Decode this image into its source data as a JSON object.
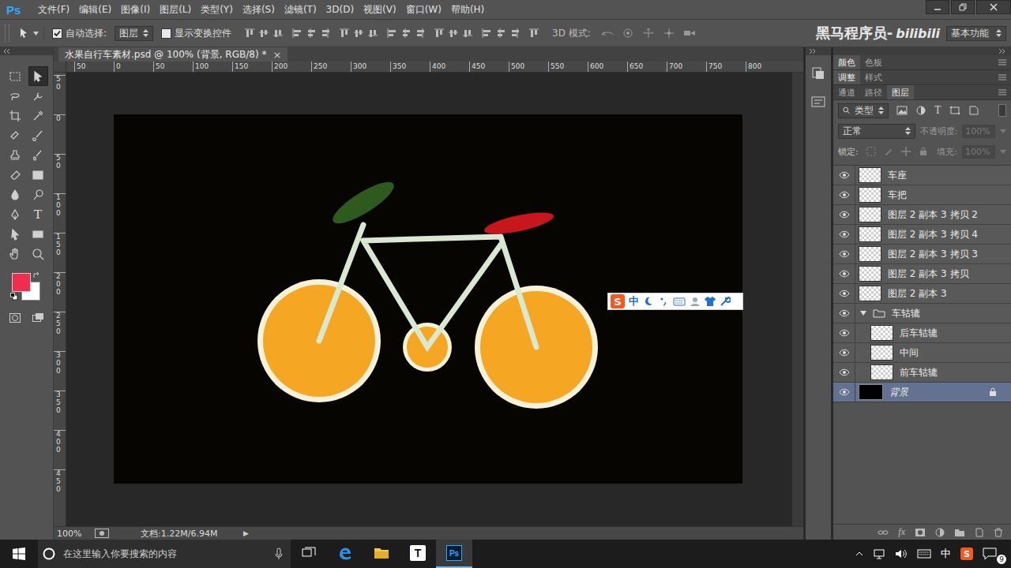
{
  "app": {
    "logo": "Ps"
  },
  "menu": [
    "文件(F)",
    "编辑(E)",
    "图像(I)",
    "图层(L)",
    "类型(Y)",
    "选择(S)",
    "滤镜(T)",
    "3D(D)",
    "视图(V)",
    "窗口(W)",
    "帮助(H)"
  ],
  "options_bar": {
    "auto_select": {
      "label": "自动选择:",
      "checked": true
    },
    "auto_select_target": "图层",
    "show_transform": {
      "label": "显示变换控件",
      "checked": false
    },
    "mode_3d_label": "3D 模式:",
    "workspace": "基本功能"
  },
  "watermark": {
    "text": "黑马程序员-",
    "brand": "bilibili"
  },
  "tools": [
    {
      "selected": false
    },
    {
      "selected": true
    },
    {
      "selected": false
    },
    {
      "selected": false
    },
    {
      "selected": false
    },
    {
      "selected": false
    },
    {
      "selected": false
    },
    {
      "selected": false
    },
    {
      "selected": false
    },
    {
      "selected": false
    },
    {
      "selected": false
    },
    {
      "selected": false
    },
    {
      "selected": false
    },
    {
      "selected": false
    },
    {
      "selected": false
    },
    {
      "selected": false,
      "glyph": "T"
    },
    {
      "selected": false
    },
    {
      "selected": false
    },
    {
      "selected": false
    },
    {
      "selected": false
    }
  ],
  "colors": {
    "foreground": "#ee2d4f",
    "background": "#ffffff"
  },
  "document": {
    "tab_title": "水果自行车素材.psd @ 100% (背景, RGB/8) *",
    "close": "×",
    "ruler_top": [
      "50",
      "0",
      "50",
      "100",
      "150",
      "200",
      "250",
      "300",
      "350",
      "400",
      "450",
      "500",
      "550",
      "600",
      "650",
      "700",
      "750",
      "800"
    ],
    "ruler_left": [
      "50",
      "0",
      "50",
      "100",
      "150",
      "200",
      "250",
      "300",
      "350",
      "400",
      "450"
    ],
    "zoom": "100%",
    "doc_info": "文档:1.22M/6.94M",
    "status_arrow": "▶"
  },
  "ime": {
    "logo": "S",
    "mode": "中"
  },
  "panels": {
    "tab_groups": [
      [
        {
          "label": "颜色",
          "selected": true
        },
        {
          "label": "色板",
          "selected": false
        }
      ],
      [
        {
          "label": "调整",
          "selected": true
        },
        {
          "label": "样式",
          "selected": false
        }
      ],
      [
        {
          "label": "通道",
          "selected": false
        },
        {
          "label": "路径",
          "selected": false
        },
        {
          "label": "图层",
          "selected": true
        }
      ]
    ],
    "filter": "类型",
    "filter_type_glyph": "T",
    "blend_mode": "正常",
    "opacity_label": "不透明度:",
    "opacity": "100%",
    "opacity_disabled": true,
    "lock_label": "锁定:",
    "fill_label": "填充:",
    "fill": "100%",
    "fill_disabled": true,
    "fx": "fx"
  },
  "layers": [
    {
      "name": "车座",
      "kind": "layer",
      "visible": true,
      "selected": false
    },
    {
      "name": "车把",
      "kind": "layer",
      "visible": true,
      "selected": false
    },
    {
      "name": "图层 2 副本 3 拷贝 2",
      "kind": "layer",
      "visible": true,
      "selected": false
    },
    {
      "name": "图层 2 副本 3 拷贝 4",
      "kind": "layer",
      "visible": true,
      "selected": false
    },
    {
      "name": "图层 2 副本 3 拷贝 3",
      "kind": "layer",
      "visible": true,
      "selected": false
    },
    {
      "name": "图层 2 副本 3 拷贝",
      "kind": "layer",
      "visible": true,
      "selected": false
    },
    {
      "name": "图层 2 副本 3",
      "kind": "layer",
      "visible": true,
      "selected": false
    },
    {
      "name": "车轱辘",
      "kind": "group",
      "visible": true,
      "selected": false,
      "expanded": true
    },
    {
      "name": "后车轱辘",
      "kind": "child",
      "visible": true,
      "selected": false
    },
    {
      "name": "中间",
      "kind": "child",
      "visible": true,
      "selected": false
    },
    {
      "name": "前车轱辘",
      "kind": "child",
      "visible": true,
      "selected": false
    },
    {
      "name": "背景",
      "kind": "background",
      "visible": true,
      "selected": true,
      "locked": true
    }
  ],
  "taskbar": {
    "search_placeholder": "在这里输入你要搜索的内容",
    "apps": [
      {
        "kind": "taskview",
        "selected": false
      },
      {
        "kind": "edge",
        "selected": false
      },
      {
        "kind": "explorer",
        "selected": false
      },
      {
        "kind": "typora",
        "glyph": "T",
        "selected": false
      },
      {
        "kind": "photoshop",
        "glyph": "Ps",
        "selected": true
      }
    ],
    "tray_ime": "中",
    "tray_sogou": "S",
    "notifications": "9"
  }
}
